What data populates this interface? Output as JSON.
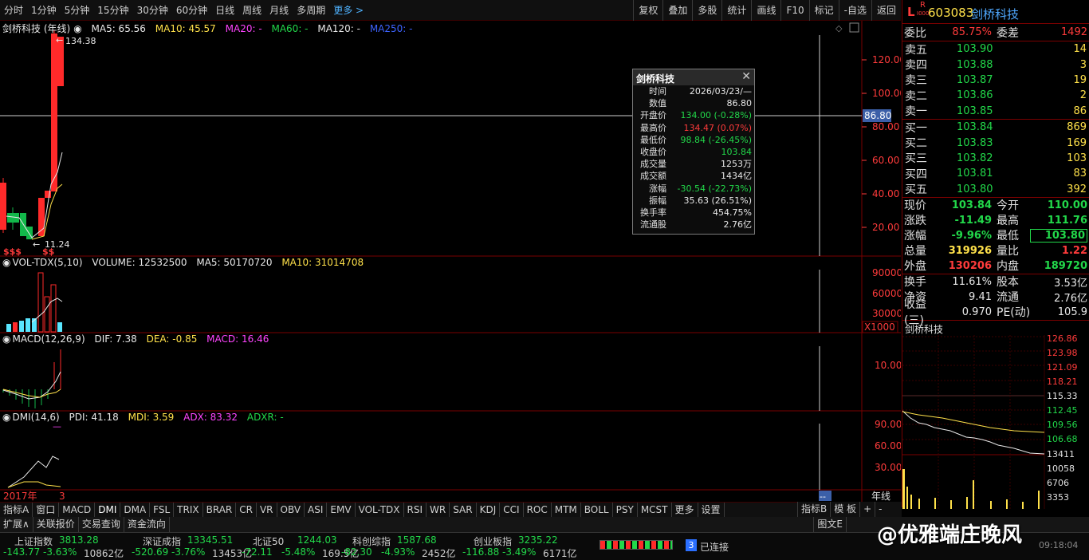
{
  "toolbar": {
    "periods": [
      "分时",
      "1分钟",
      "5分钟",
      "15分钟",
      "30分钟",
      "60分钟",
      "日线",
      "周线",
      "月线",
      "多周期"
    ],
    "more_label": "更多 >",
    "tools": [
      "复权",
      "叠加",
      "多股",
      "统计",
      "画线",
      "F10",
      "标记",
      "-自选",
      "返回"
    ]
  },
  "main_chart": {
    "title": "剑桥科技 (年线)",
    "ma5": "MA5: 65.56",
    "ma10": "MA10: 45.57",
    "ma20": "MA20: -",
    "ma60": "MA60: -",
    "ma120": "MA120: -",
    "ma250": "MA250: -",
    "high_label": "134.38",
    "low_label": "11.24",
    "crosshair_label": "86.80",
    "y_ticks": [
      "120.00",
      "100.00",
      "80.00",
      "60.00",
      "40.00",
      "20.00"
    ],
    "markers": "$$$",
    "markers2": "$$"
  },
  "volume_panel": {
    "title": "VOL-TDX(5,10)",
    "volume": "VOLUME: 12532500",
    "ma5": "MA5: 50170720",
    "ma10": "MA10: 31014708",
    "y_ticks": [
      "90000",
      "60000",
      "30000"
    ],
    "unit": "X1000"
  },
  "macd_panel": {
    "title": "MACD(12,26,9)",
    "dif": "DIF: 7.38",
    "dea": "DEA: -0.85",
    "macd": "MACD: 16.46",
    "y_ticks": [
      "10.00"
    ]
  },
  "dmi_panel": {
    "title": "DMI(14,6)",
    "pdi": "PDI: 41.18",
    "mdi": "MDI: 3.59",
    "adx": "ADX: 83.32",
    "adxr": "ADXR: -",
    "y_ticks": [
      "90.00",
      "60.00",
      "30.00"
    ]
  },
  "x_axis": {
    "start_label": "2017年",
    "mid_label": "3",
    "period_label": "年线",
    "cursor_label": "--"
  },
  "tooltip": {
    "title": "剑桥科技",
    "rows": [
      {
        "k": "时间",
        "v": "2026/03/23/—",
        "c": "white"
      },
      {
        "k": "数值",
        "v": "86.80",
        "c": "white"
      },
      {
        "k": "开盘价",
        "v": "134.00 (-0.28%)",
        "c": "green"
      },
      {
        "k": "最高价",
        "v": "134.47 (0.07%)",
        "c": "red"
      },
      {
        "k": "最低价",
        "v": "98.84 (-26.45%)",
        "c": "green"
      },
      {
        "k": "收盘价",
        "v": "103.84",
        "c": "green"
      },
      {
        "k": "成交量",
        "v": "1253万",
        "c": "white"
      },
      {
        "k": "成交额",
        "v": "1434亿",
        "c": "white"
      },
      {
        "k": "涨幅",
        "v": "-30.54 (-22.73%)",
        "c": "green"
      },
      {
        "k": "振幅",
        "v": "35.63 (26.51%)",
        "c": "white"
      },
      {
        "k": "换手率",
        "v": "454.75%",
        "c": "white"
      },
      {
        "k": "流通股",
        "v": "2.76亿",
        "c": "white"
      }
    ]
  },
  "quote": {
    "flag": "L",
    "flag_sub": "R",
    "flag_sub2": "I000",
    "code": "603083",
    "name": "剑桥科技",
    "weibi_label": "委比",
    "weibi": "85.75%",
    "weicha_label": "委差",
    "weicha": "1492",
    "asks": [
      {
        "label": "卖五",
        "price": "103.90",
        "vol": "14"
      },
      {
        "label": "卖四",
        "price": "103.88",
        "vol": "3"
      },
      {
        "label": "卖三",
        "price": "103.87",
        "vol": "19"
      },
      {
        "label": "卖二",
        "price": "103.86",
        "vol": "2"
      },
      {
        "label": "卖一",
        "price": "103.85",
        "vol": "86"
      }
    ],
    "bids": [
      {
        "label": "买一",
        "price": "103.84",
        "vol": "869"
      },
      {
        "label": "买二",
        "price": "103.83",
        "vol": "169"
      },
      {
        "label": "买三",
        "price": "103.82",
        "vol": "103"
      },
      {
        "label": "买四",
        "price": "103.81",
        "vol": "83"
      },
      {
        "label": "买五",
        "price": "103.80",
        "vol": "392"
      }
    ],
    "stats": [
      {
        "k": "现价",
        "v": "103.84",
        "vc": "green",
        "k2": "今开",
        "v2": "110.00",
        "v2c": "green"
      },
      {
        "k": "涨跌",
        "v": "-11.49",
        "vc": "green",
        "k2": "最高",
        "v2": "111.76",
        "v2c": "green"
      },
      {
        "k": "涨幅",
        "v": "-9.96%",
        "vc": "green",
        "k2": "最低",
        "v2": "103.80",
        "v2c": "green"
      },
      {
        "k": "总量",
        "v": "319926",
        "vc": "yellow",
        "k2": "量比",
        "v2": "1.22",
        "v2c": "red"
      },
      {
        "k": "外盘",
        "v": "130206",
        "vc": "red",
        "k2": "内盘",
        "v2": "189720",
        "v2c": "green"
      }
    ],
    "stats2": [
      {
        "k": "换手",
        "v": "11.61%",
        "k2": "股本",
        "v2": "3.53亿"
      },
      {
        "k": "净资",
        "v": "9.41",
        "k2": "流通",
        "v2": "2.76亿"
      },
      {
        "k": "收益(三)",
        "v": "0.970",
        "k2": "PE(动)",
        "v2": "105.9"
      }
    ],
    "mini_title": "剑桥科技",
    "mini_y_ticks": [
      "126.86",
      "123.98",
      "121.09",
      "118.21",
      "115.33",
      "112.45",
      "109.56",
      "106.68"
    ],
    "mini_vol_ticks": [
      "13411",
      "10058",
      "6706",
      "3353"
    ]
  },
  "indicator_tabs": [
    "指标A",
    "窗口",
    "MACD",
    "DMI",
    "DMA",
    "FSL",
    "TRIX",
    "BRAR",
    "CR",
    "VR",
    "OBV",
    "ASI",
    "EMV",
    "VOL-TDX",
    "RSI",
    "WR",
    "SAR",
    "KDJ",
    "CCI",
    "ROC",
    "MTM",
    "BOLL",
    "PSY",
    "MCST",
    "更多",
    "设置"
  ],
  "indicator_tabs_right": [
    "指标B",
    "模 板",
    "+",
    "-"
  ],
  "bottom_tabs": [
    "扩展∧",
    "关联报价",
    "交易查询",
    "资金流向"
  ],
  "bottom_right": "图文E",
  "status": {
    "indices": [
      {
        "name": "上证指数",
        "value": "3813.28",
        "chg": "-143.77",
        "pct": "-3.63%",
        "amt": "10862亿"
      },
      {
        "name": "深证成指",
        "value": "13345.51",
        "chg": "-520.69",
        "pct": "-3.76%",
        "amt": "13453亿"
      },
      {
        "name": "北证50",
        "value": "1244.03",
        "chg": "-72.11",
        "pct": "-5.48%",
        "amt": "169.5亿"
      },
      {
        "name": "科创综指",
        "value": "1587.68",
        "chg": "-82.30",
        "pct": "-4.93%",
        "amt": "2452亿"
      },
      {
        "name": "创业板指",
        "value": "3235.22",
        "chg": "-116.88",
        "pct": "-3.49%",
        "amt": "6171亿"
      }
    ],
    "conn_num": "3",
    "conn_text": "已连接",
    "watermark": "@优雅端庄晚风",
    "time": "09:18:04"
  }
}
